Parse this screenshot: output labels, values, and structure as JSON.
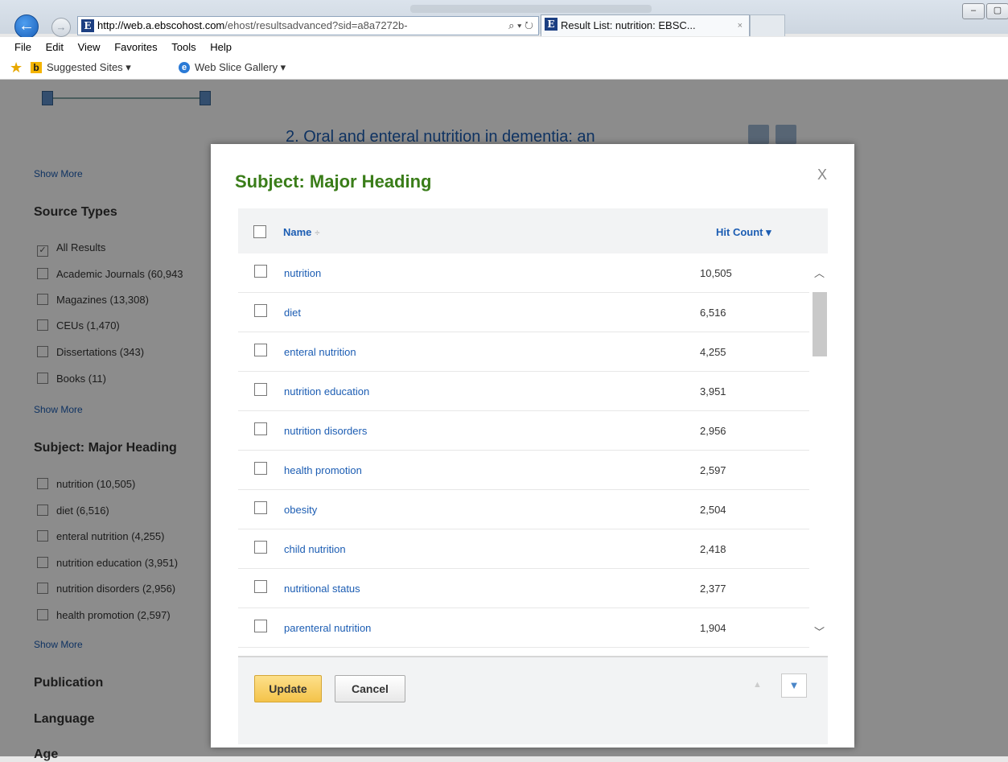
{
  "browser": {
    "address": {
      "favicon": "E",
      "host": "http://web.a.ebscohost.com",
      "path": "/ehost/resultsadvanced?sid=a8a7272b-",
      "icons": "⌕ ▾ ↻"
    },
    "tab": {
      "favicon": "E",
      "label": "Result List: nutrition: EBSC...",
      "close": "×"
    },
    "menu": [
      "File",
      "Edit",
      "View",
      "Favorites",
      "Tools",
      "Help"
    ],
    "favorites": {
      "suggested": "Suggested Sites ▾",
      "webslice": "Web Slice Gallery ▾"
    }
  },
  "sidebar": {
    "show_more_label": "Show More",
    "source_types": {
      "heading": "Source Types",
      "items": [
        {
          "label": "All Results",
          "checked": true
        },
        {
          "label": "Academic Journals (60,943",
          "checked": false
        },
        {
          "label": "Magazines (13,308)",
          "checked": false
        },
        {
          "label": "CEUs (1,470)",
          "checked": false
        },
        {
          "label": "Dissertations (343)",
          "checked": false
        },
        {
          "label": "Books (11)",
          "checked": false
        }
      ]
    },
    "subject": {
      "heading": "Subject: Major Heading",
      "items": [
        {
          "label": "nutrition (10,505)"
        },
        {
          "label": "diet (6,516)"
        },
        {
          "label": "enteral nutrition (4,255)"
        },
        {
          "label": "nutrition education (3,951)"
        },
        {
          "label": "nutrition disorders (2,956)"
        },
        {
          "label": "health promotion (2,597)"
        }
      ]
    },
    "publication": "Publication",
    "language": "Language",
    "age": "Age"
  },
  "background_result": "2. Oral and enteral nutrition in dementia: an",
  "modal": {
    "title": "Subject: Major Heading",
    "close": "X",
    "col_name": "Name",
    "col_hits": "Hit Count ▾",
    "sort_glyph": "÷",
    "rows": [
      {
        "name": "nutrition",
        "hits": "10,505"
      },
      {
        "name": "diet",
        "hits": "6,516"
      },
      {
        "name": "enteral nutrition",
        "hits": "4,255"
      },
      {
        "name": "nutrition education",
        "hits": "3,951"
      },
      {
        "name": "nutrition disorders",
        "hits": "2,956"
      },
      {
        "name": "health promotion",
        "hits": "2,597"
      },
      {
        "name": "obesity",
        "hits": "2,504"
      },
      {
        "name": "child nutrition",
        "hits": "2,418"
      },
      {
        "name": "nutritional status",
        "hits": "2,377"
      },
      {
        "name": "parenteral nutrition",
        "hits": "1,904"
      }
    ],
    "update_label": "Update",
    "cancel_label": "Cancel",
    "prev_glyph": "▲",
    "next_glyph": "▼"
  }
}
